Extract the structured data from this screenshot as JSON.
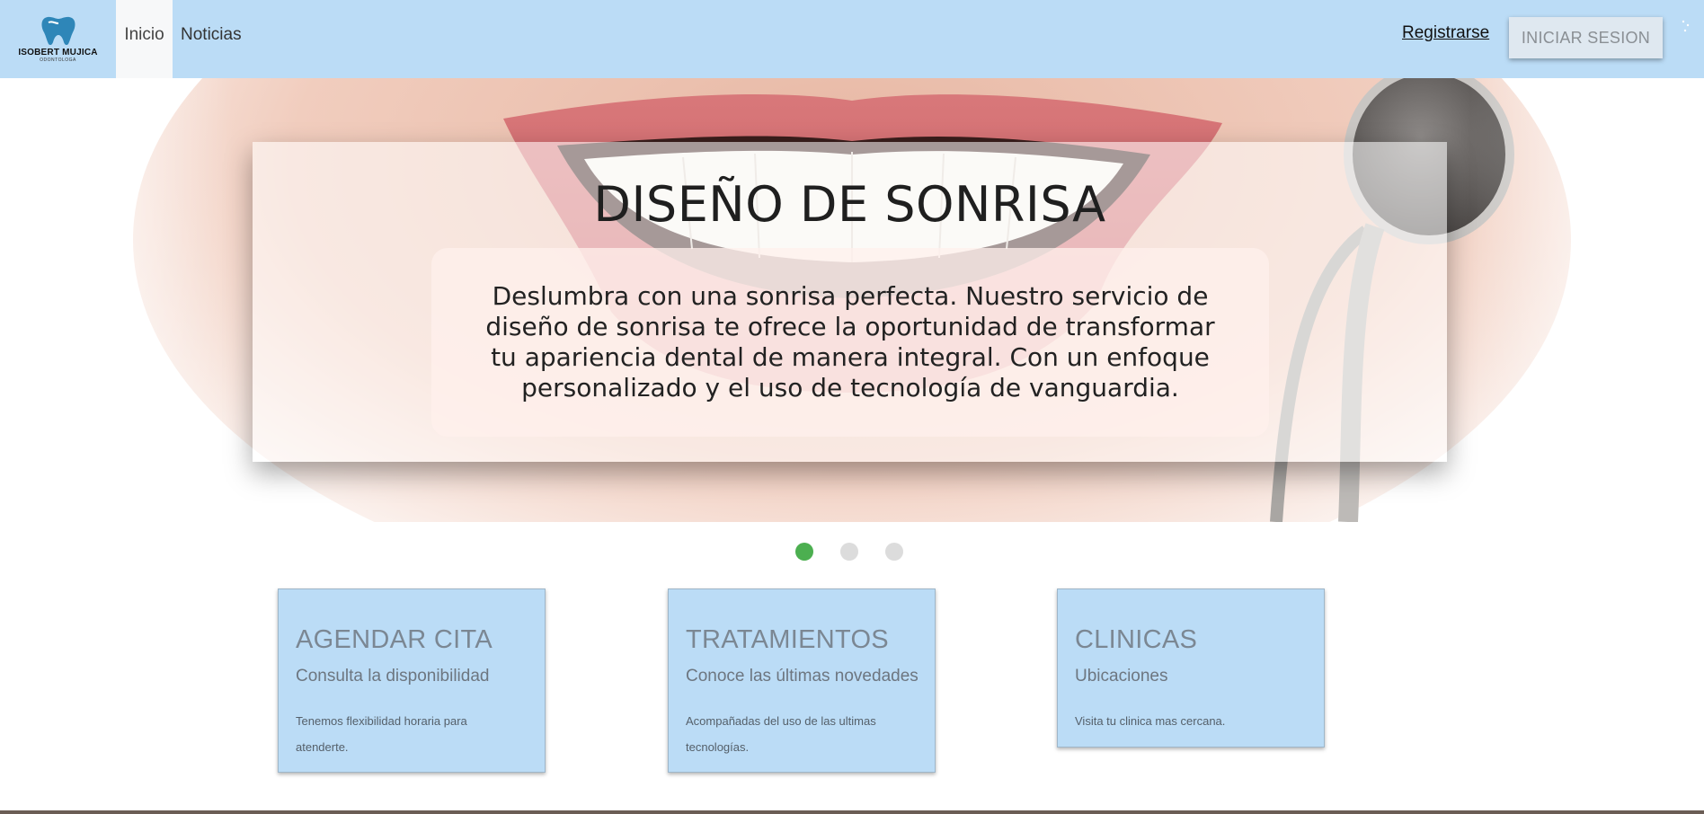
{
  "brand": {
    "name": "ISOBERT MUJICA",
    "tagline": "ODONTOLOGA",
    "logo_icon": "tooth-icon",
    "logo_color": "#2e86b8"
  },
  "nav": {
    "links": [
      {
        "label": "Inicio",
        "active": true
      },
      {
        "label": "Noticias",
        "active": false
      }
    ],
    "register_label": "Registrarse",
    "login_label": "INICIAR SESION",
    "background": "#bbdcf6"
  },
  "hero": {
    "title": "DISEÑO DE SONRISA",
    "text": "Deslumbra con una sonrisa perfecta. Nuestro servicio de diseño de sonrisa te ofrece la oportunidad de transformar tu apariencia dental de manera integral. Con un enfoque personalizado y el uso de tecnología de vanguardia.",
    "image": "smile-with-dental-mirror",
    "slide_count": 3,
    "active_slide": 1,
    "active_dot_color": "#4caf50"
  },
  "cards": [
    {
      "title": "AGENDAR CITA",
      "subtitle": "Consulta la disponibilidad",
      "text": "Tenemos flexibilidad horaria para atenderte."
    },
    {
      "title": "TRATAMIENTOS",
      "subtitle": "Conoce las últimas novedades",
      "text": "Acompañadas del uso de las ultimas tecnologías."
    },
    {
      "title": "CLINICAS",
      "subtitle": "Ubicaciones",
      "text": "Visita tu clinica mas cercana."
    }
  ]
}
